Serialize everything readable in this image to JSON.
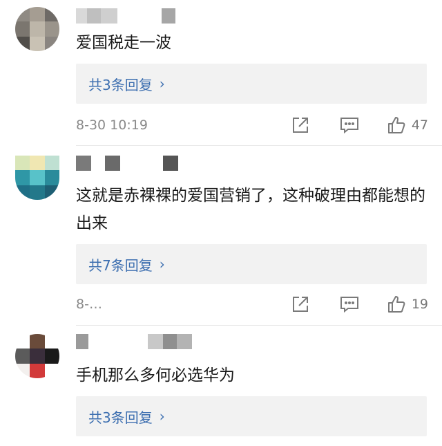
{
  "comments": [
    {
      "text": "爱国税走一波",
      "replies_label": "共3条回复",
      "time": "8-30 10:19",
      "likes": "47",
      "avatar_colors": [
        "#8f8a83",
        "#a59d92",
        "#6e6a66",
        "#7b766f",
        "#bdb6a9",
        "#9a948b",
        "#514e4a",
        "#c9c2b4",
        "#8a8580"
      ],
      "name_colors": [
        "#d9d9d9",
        "#bfbfbf",
        "#ffffff",
        "#ffffff",
        "#ffffff",
        "#a6a6a6"
      ]
    },
    {
      "text": "这就是赤裸裸的爱国营销了，这种破理由都能想的出来",
      "replies_label": "共7条回复",
      "time": "8-…",
      "likes": "19",
      "avatar_colors": [
        "#d9e6b8",
        "#f0e7b2",
        "#bfe0d2",
        "#2f97a6",
        "#58c2c9",
        "#2a8b9b",
        "#1f6f86",
        "#23788a",
        "#1e5f74"
      ],
      "name_colors": [
        "#7a7a7a",
        "#ffffff",
        "#6a6a6a",
        "#ffffff",
        "#ffffff",
        "#555555"
      ]
    },
    {
      "text": "手机那么多何必选华为",
      "replies_label": "共3条回复",
      "avatar_colors": [
        "#ffffff",
        "#6a4b3a",
        "#ffffff",
        "#5b5b5b",
        "#3a2e3b",
        "#1a1a1a",
        "#f3f0ee",
        "#d23a3a",
        "#ffffff"
      ],
      "name_colors": [
        "#9a9a9a",
        "#ffffff",
        "#ffffff",
        "#c8c8c8",
        "#8f8f8f",
        "#b3b3b3"
      ]
    }
  ],
  "icons": {
    "repost": "share-external-icon",
    "comment": "comment-icon",
    "like": "thumbs-up-icon"
  },
  "colors": {
    "link": "#3d6fb0",
    "meta": "#8a8a8a",
    "reply_bg": "#f2f2f2",
    "icon": "#7a7a7a"
  }
}
